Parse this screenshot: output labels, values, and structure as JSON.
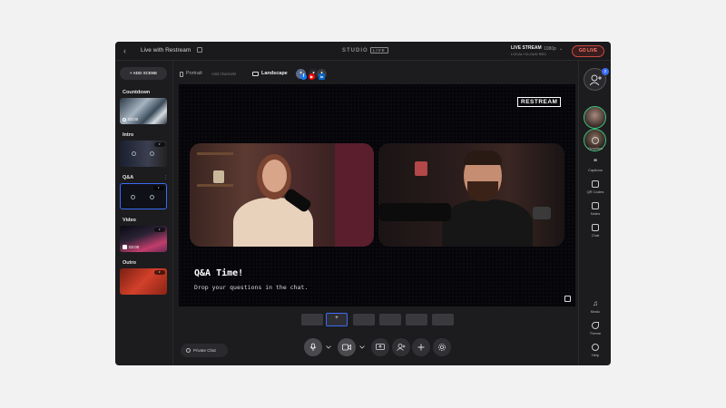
{
  "topbar": {
    "title": "Live with Restream",
    "studio": "STUDIO",
    "studio_badge": "LIVE",
    "stream_label": "LIVE STREAM",
    "stream_sub": "LOCAL+CLOUD REC.",
    "quality": "1080p",
    "go_live": "GO LIVE"
  },
  "sidebar": {
    "add_scene": "+ ADD SCENE",
    "scenes": [
      {
        "label": "Countdown",
        "thumb_text": "03:00"
      },
      {
        "label": "Intro",
        "thumb_text": ""
      },
      {
        "label": "Q&A",
        "thumb_text": ""
      },
      {
        "label": "Video",
        "thumb_text": "02:00"
      },
      {
        "label": "Outro",
        "thumb_text": ""
      }
    ],
    "private_chat": "Private Chat"
  },
  "orientation": {
    "portrait": "Portrait",
    "add_channels": "Add channels",
    "landscape": "Landscape"
  },
  "canvas": {
    "brand": "RESTREAM",
    "caption_title": "Q&A Time!",
    "caption_sub": "Drop your questions in the chat."
  },
  "rail": {
    "badge_count": "2",
    "items": [
      "Graphics",
      "Captions",
      "QR Codes",
      "Notes",
      "Chat",
      "Music",
      "Theme",
      "Help"
    ]
  },
  "colors": {
    "accent": "#3b6cf5",
    "go_live": "#ff7a66",
    "online": "#3ac27a"
  }
}
